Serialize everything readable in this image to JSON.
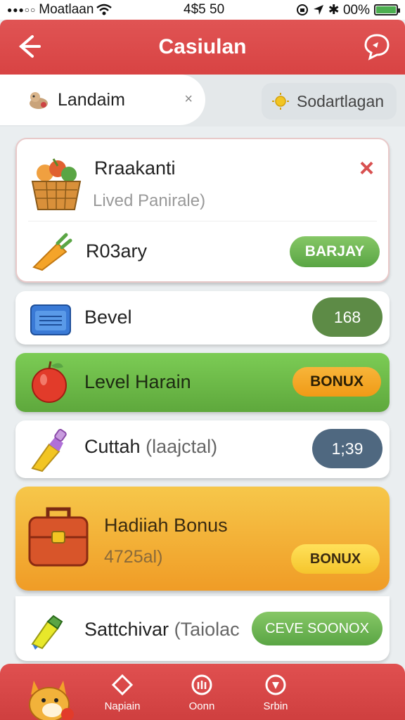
{
  "status_bar": {
    "carrier": "Moatlaan",
    "time": "4$5 50",
    "battery": "✱ 00%"
  },
  "header": {
    "title": "Casiulan",
    "back_icon": "arrow-left-icon",
    "chat_icon": "chat-bubble-icon"
  },
  "tabs": {
    "active_label": "Landaim",
    "active_close": "×",
    "other_label": "Sodartlagan"
  },
  "main_card": {
    "heading": "Rraakanti",
    "subtitle": "Lived Panirale)",
    "close": "×",
    "row_label": "R03ary",
    "row_button": "BARJAY"
  },
  "rows": {
    "bevel": {
      "label": "Bevel",
      "value": "168"
    },
    "level": {
      "label": "Level Harain",
      "button": "BONUX"
    },
    "cuttah": {
      "label": "Cuttah",
      "label_paren": "(laajctal)",
      "value": "1;39"
    },
    "satchi": {
      "label": "Sattchivar",
      "label_paren": "(Taiolac",
      "button": "CEVE SOONOX"
    }
  },
  "bonus_card": {
    "heading": "Hadiiah Bonus",
    "subtitle": "4725al)",
    "button": "BONUX"
  },
  "bottom_nav": {
    "items": [
      {
        "label": "Napiain",
        "icon": "diamond-icon"
      },
      {
        "label": "Oonn",
        "icon": "gift-icon"
      },
      {
        "label": "Srbin",
        "icon": "shield-icon"
      }
    ]
  },
  "colors": {
    "header_red": "#d84343",
    "green": "#5aa544",
    "orange": "#f09c26",
    "slate": "#4f6880"
  }
}
